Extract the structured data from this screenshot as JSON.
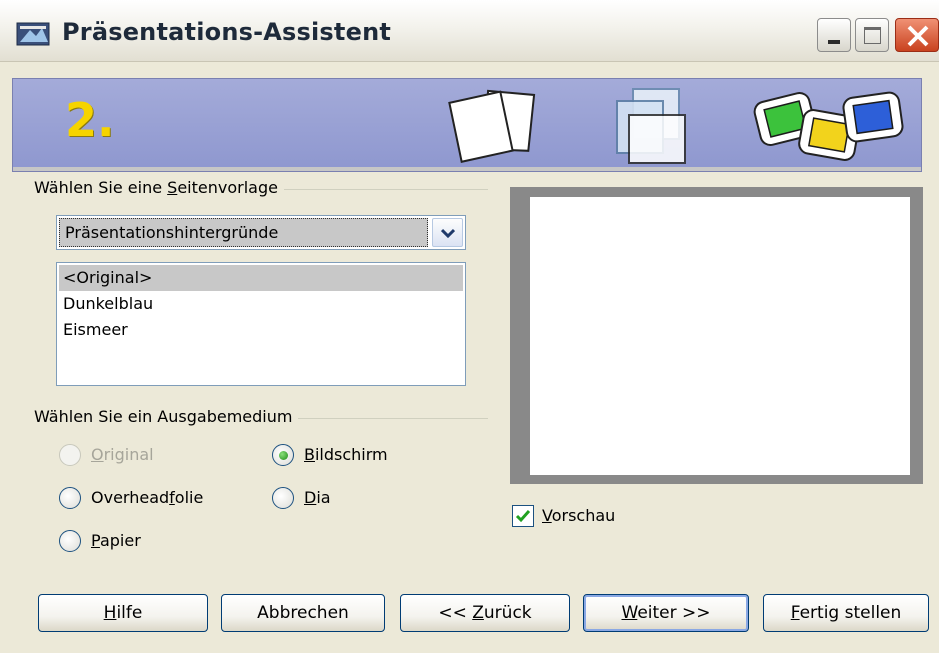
{
  "window": {
    "title": "Präsentations-Assistent"
  },
  "banner": {
    "step": "2."
  },
  "page_template": {
    "group_label_pre": "Wählen Sie eine ",
    "group_label_key": "S",
    "group_label_post": "eitenvorlage",
    "dropdown_value": "Präsentationshintergründe",
    "list_items": [
      "<Original>",
      "Dunkelblau",
      "Eismeer"
    ],
    "selected_index": 0
  },
  "output_medium": {
    "group_label": "Wählen Sie ein Ausgabemedium",
    "options": [
      {
        "pre": "",
        "key": "O",
        "post": "riginal",
        "checked": false,
        "enabled": false
      },
      {
        "pre": "",
        "key": "B",
        "post": "ildschirm",
        "checked": true,
        "enabled": true
      },
      {
        "pre": "Overhead",
        "key": "f",
        "post": "olie",
        "checked": false,
        "enabled": true
      },
      {
        "pre": "",
        "key": "D",
        "post": "ia",
        "checked": false,
        "enabled": true
      },
      {
        "pre": "",
        "key": "P",
        "post": "apier",
        "checked": false,
        "enabled": true
      }
    ]
  },
  "preview": {
    "checkbox_key": "V",
    "checkbox_post": "orschau",
    "checked": true
  },
  "buttons": {
    "help": {
      "pre": "",
      "key": "H",
      "post": "ilfe"
    },
    "cancel": {
      "label": "Abbrechen"
    },
    "back": {
      "pre": "<< ",
      "key": "Z",
      "post": "urück"
    },
    "next": {
      "pre": "",
      "key": "W",
      "post": "eiter >>"
    },
    "finish": {
      "pre": "",
      "key": "F",
      "post": "ertig stellen"
    }
  },
  "colors": {
    "window_bg": "#ece9d8",
    "banner": "#969fd3",
    "step_number": "#f6d400",
    "preview_frame": "#898989",
    "close_button": "#d9502b"
  }
}
